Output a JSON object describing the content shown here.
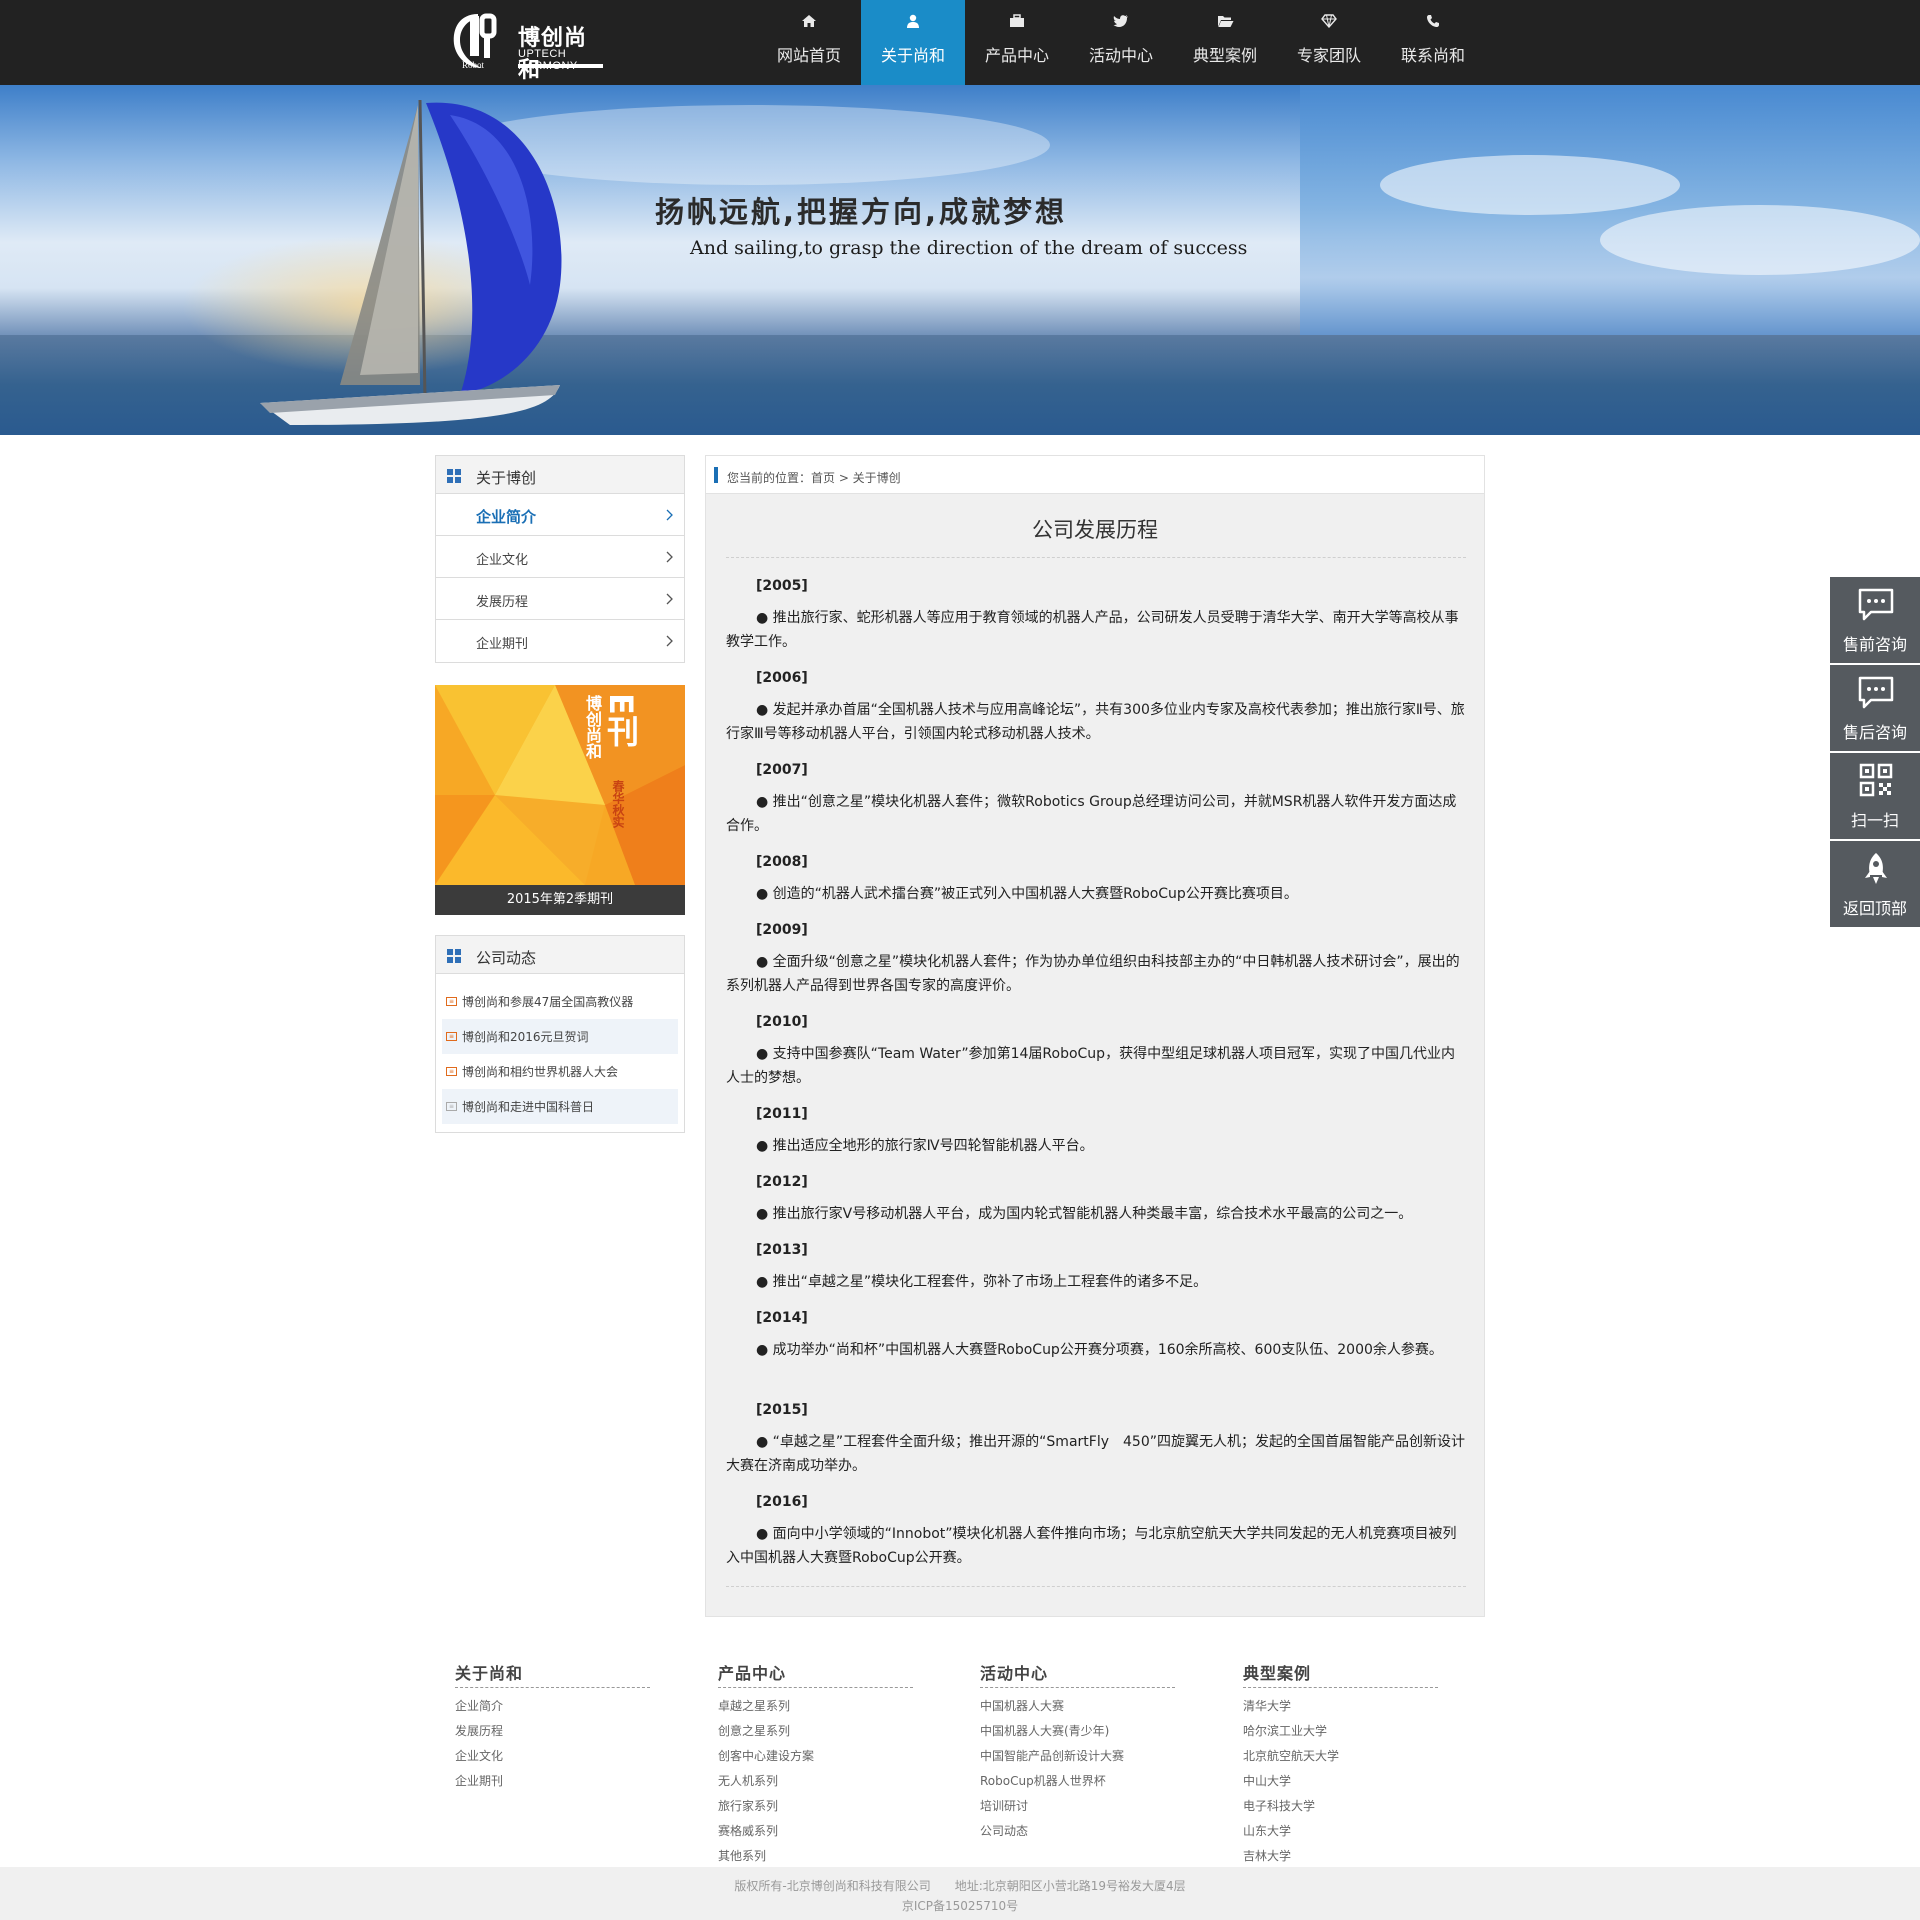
{
  "brand": {
    "name_cn": "博创尚和",
    "name_en": "UPTECH HARMONY",
    "mark_text": "Robot"
  },
  "nav": [
    {
      "label": "网站首页",
      "icon": "home-icon",
      "active": false
    },
    {
      "label": "关于尚和",
      "icon": "user-icon",
      "active": true
    },
    {
      "label": "产品中心",
      "icon": "briefcase-icon",
      "active": false
    },
    {
      "label": "活动中心",
      "icon": "twitter-bird-icon",
      "active": false
    },
    {
      "label": "典型案例",
      "icon": "folder-open-icon",
      "active": false
    },
    {
      "label": "专家团队",
      "icon": "diamond-icon",
      "active": false
    },
    {
      "label": "联系尚和",
      "icon": "phone-icon",
      "active": false
    }
  ],
  "banner": {
    "title": "扬帆远航,把握方向,成就梦想",
    "subtitle": "And sailing,to grasp the direction of the dream of success"
  },
  "sidebar": {
    "about": {
      "title": "关于博创",
      "items": [
        {
          "label": "企业简介",
          "active": true
        },
        {
          "label": "企业文化",
          "active": false
        },
        {
          "label": "发展历程",
          "active": false
        },
        {
          "label": "企业期刊",
          "active": false
        }
      ]
    },
    "ekan": {
      "caption": "2015年第2季期刊",
      "cover_title": "博创尚和",
      "cover_big": "E刊",
      "cover_season": "春华秋实"
    },
    "news": {
      "title": "公司动态",
      "items": [
        {
          "label": "博创尚和参展47届全国高教仪器",
          "icon": "news-icon"
        },
        {
          "label": "博创尚和2016元旦贺词",
          "icon": "news-icon"
        },
        {
          "label": "博创尚和相约世界机器人大会",
          "icon": "news-icon"
        },
        {
          "label": "博创尚和走进中国科普日",
          "icon": "news-icon-grey"
        }
      ]
    }
  },
  "main": {
    "breadcrumb": "您当前的位置：首页 > 关于博创",
    "title": "公司发展历程",
    "entries": [
      {
        "year": "[2005]",
        "text": "● 推出旅行家、蛇形机器人等应用于教育领域的机器人产品，公司研发人员受聘于清华大学、南开大学等高校从事教学工作。"
      },
      {
        "year": "[2006]",
        "text": "● 发起并承办首届“全国机器人技术与应用高峰论坛”，共有300多位业内专家及高校代表参加；推出旅行家Ⅱ号、旅行家Ⅲ号等移动机器人平台，引领国内轮式移动机器人技术。"
      },
      {
        "year": "[2007]",
        "text": "● 推出“创意之星”模块化机器人套件；微软Robotics Group总经理访问公司，并就MSR机器人软件开发方面达成合作。"
      },
      {
        "year": "[2008]",
        "text": "● 创造的“机器人武术擂台赛”被正式列入中国机器人大赛暨RoboCup公开赛比赛项目。"
      },
      {
        "year": "[2009]",
        "text": "● 全面升级“创意之星”模块化机器人套件；作为协办单位组织由科技部主办的“中日韩机器人技术研讨会”，展出的系列机器人产品得到世界各国专家的高度评价。"
      },
      {
        "year": "[2010]",
        "text": "● 支持中国参赛队“Team Water”参加第14届RoboCup，获得中型组足球机器人项目冠军，实现了中国几代业内人士的梦想。"
      },
      {
        "year": "[2011]",
        "text": "● 推出适应全地形的旅行家Ⅳ号四轮智能机器人平台。"
      },
      {
        "year": "[2012]",
        "text": "● 推出旅行家Ⅴ号移动机器人平台，成为国内轮式智能机器人种类最丰富，综合技术水平最高的公司之一。"
      },
      {
        "year": "[2013]",
        "text": "● 推出“卓越之星”模块化工程套件，弥补了市场上工程套件的诸多不足。"
      },
      {
        "year": "[2014]",
        "text": "● 成功举办“尚和杯”中国机器人大赛暨RoboCup公开赛分项赛，160余所高校、600支队伍、2000余人参赛。"
      },
      {
        "year": "[2015]",
        "text": "● “卓越之星”工程套件全面升级；推出开源的“SmartFly　450”四旋翼无人机；发起的全国首届智能产品创新设计大赛在济南成功举办。"
      },
      {
        "year": "[2016]",
        "text": "● 面向中小学领域的“Innobot”模块化机器人套件推向市场；与北京航空航天大学共同发起的无人机竞赛项目被列入中国机器人大赛暨RoboCup公开赛。"
      }
    ]
  },
  "footer": {
    "columns": [
      {
        "title": "关于尚和",
        "links": [
          "企业简介",
          "发展历程",
          "企业文化",
          "企业期刊"
        ]
      },
      {
        "title": "产品中心",
        "links": [
          "卓越之星系列",
          "创意之星系列",
          "创客中心建设方案",
          "无人机系列",
          "旅行家系列",
          "赛格威系列",
          "其他系列"
        ]
      },
      {
        "title": "活动中心",
        "links": [
          "中国机器人大赛",
          "中国机器人大赛(青少年)",
          "中国智能产品创新设计大赛",
          "RoboCup机器人世界杯",
          "培训研讨",
          "公司动态"
        ]
      },
      {
        "title": "典型案例",
        "links": [
          "清华大学",
          "哈尔滨工业大学",
          "北京航空航天大学",
          "中山大学",
          "电子科技大学",
          "山东大学",
          "吉林大学"
        ]
      }
    ],
    "copyright": "版权所有-北京博创尚和科技有限公司　　地址:北京朝阳区小营北路19号裕发大厦4层",
    "icp": "京ICP备15025710号"
  },
  "float_bar": [
    {
      "label": "售前咨询",
      "icon": "chat-icon"
    },
    {
      "label": "售后咨询",
      "icon": "chat-icon"
    },
    {
      "label": "扫一扫",
      "icon": "qr-code-icon"
    },
    {
      "label": "返回顶部",
      "icon": "rocket-icon"
    }
  ],
  "colors": {
    "header_bg": "#222222",
    "nav_active": "#1a8cc8",
    "sidebar_active_text": "#1a6fb5",
    "float_bg": "#555a5f"
  }
}
